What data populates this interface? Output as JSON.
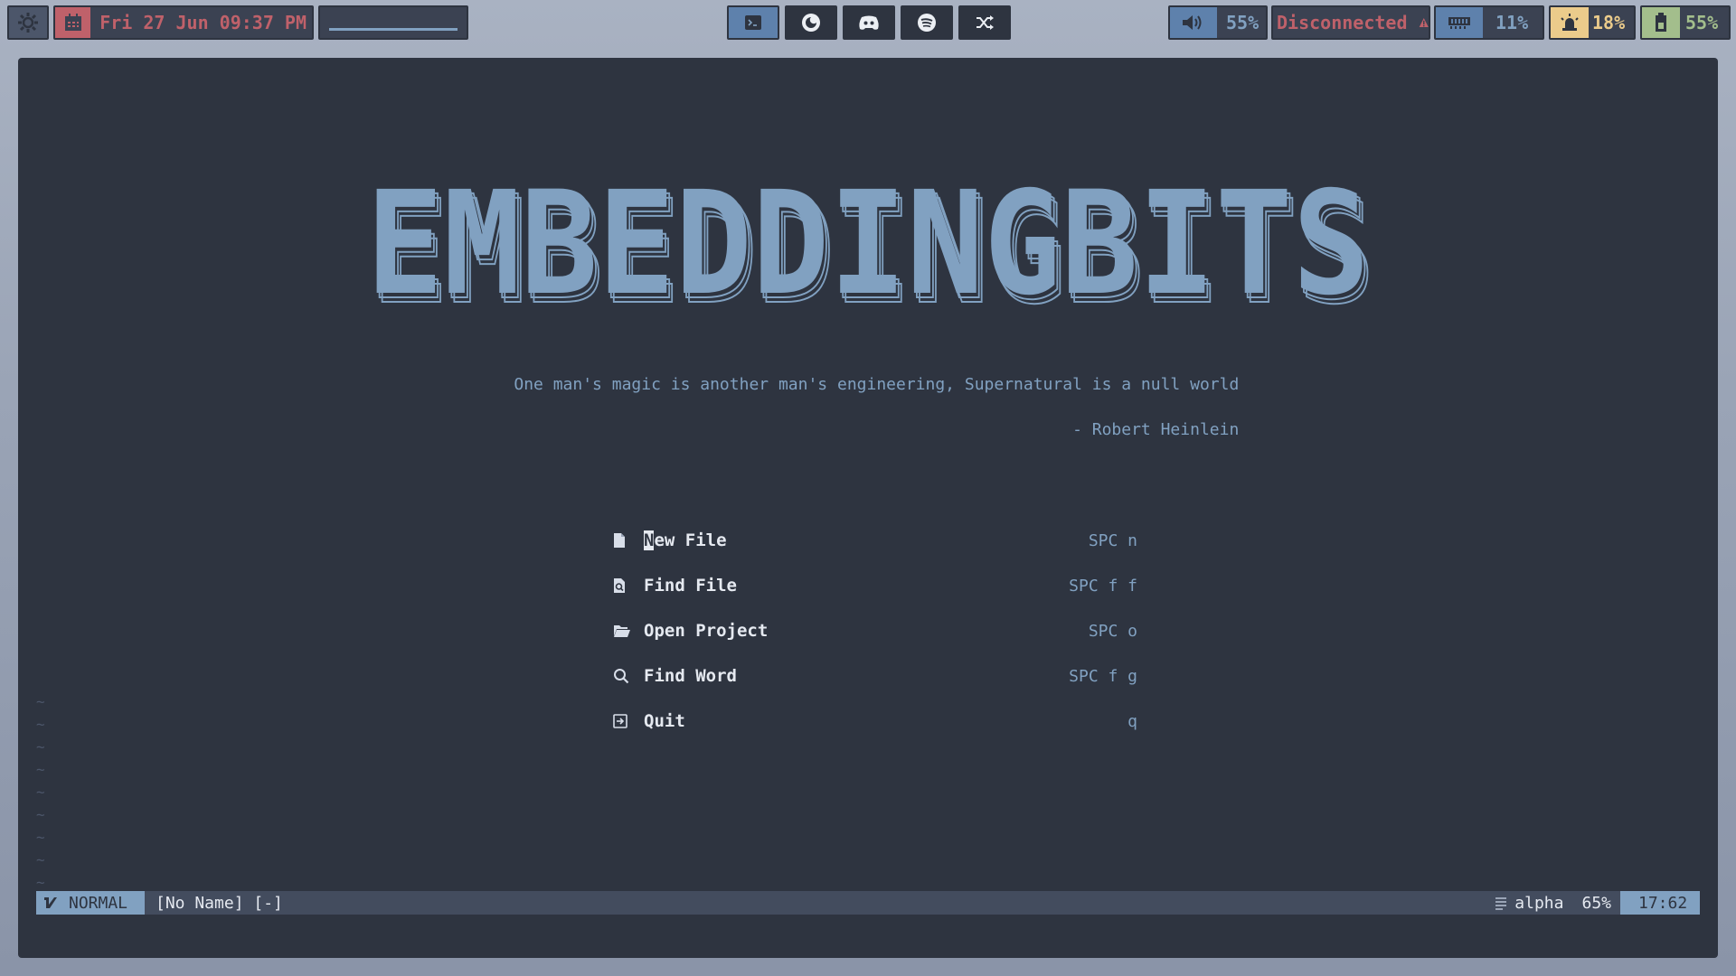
{
  "topbar": {
    "settings_icon": "gear-icon",
    "date": {
      "icon": "calendar-icon",
      "text": "Fri 27 Jun 09:37 PM"
    },
    "apps": [
      "terminal-icon",
      "firefox-icon",
      "discord-icon",
      "spotify-icon",
      "shuffle-icon"
    ],
    "volume": {
      "icon": "speaker-icon",
      "text": "55%"
    },
    "network": {
      "text": "Disconnected",
      "icon": "warning-icon"
    },
    "memory": {
      "icon": "memory-icon",
      "text": "11%"
    },
    "cpu": {
      "icon": "cpu-alarm-icon",
      "text": "18%"
    },
    "battery": {
      "icon": "battery-icon",
      "text": "55%"
    }
  },
  "dashboard": {
    "banner": "EMBEDDINGBITS",
    "quote": "One man's magic is another man's engineering, Supernatural is a null world",
    "author": "- Robert Heinlein",
    "menu": [
      {
        "icon": "file-icon",
        "label_first": "N",
        "label_rest": "ew File",
        "key": "SPC n"
      },
      {
        "icon": "find-file-icon",
        "label": "Find File",
        "key": "SPC f f"
      },
      {
        "icon": "folder-open-icon",
        "label": "Open Project",
        "key": "SPC o"
      },
      {
        "icon": "search-icon",
        "label": "Find Word",
        "key": "SPC f g"
      },
      {
        "icon": "quit-icon",
        "label": "Quit",
        "key": "q"
      }
    ]
  },
  "statusline": {
    "mode": "NORMAL",
    "filename": "[No Name] [-]",
    "filetype": "alpha",
    "percent": "65%",
    "position": "17:62"
  },
  "colors": {
    "bg": "#2e3440",
    "accent": "#81a1c1",
    "red": "#bf616a",
    "yellow": "#ebcb8b",
    "green": "#a3be8c"
  }
}
